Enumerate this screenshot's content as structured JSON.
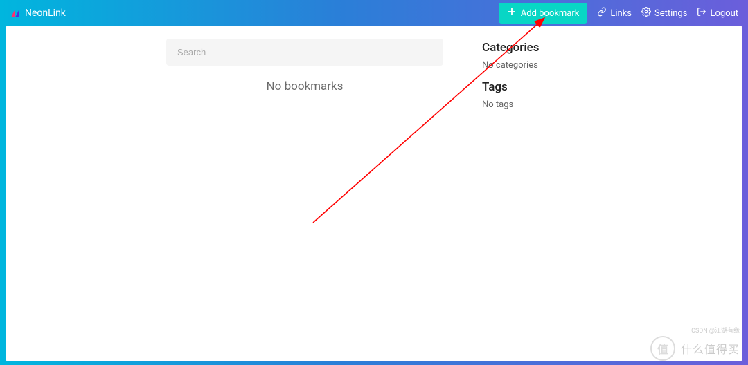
{
  "brand": {
    "name": "NeonLink"
  },
  "nav": {
    "add_bookmark": "Add bookmark",
    "links": "Links",
    "settings": "Settings",
    "logout": "Logout"
  },
  "search": {
    "placeholder": "Search"
  },
  "main": {
    "empty_message": "No bookmarks"
  },
  "sidebar": {
    "categories_heading": "Categories",
    "categories_empty": "No categories",
    "tags_heading": "Tags",
    "tags_empty": "No tags"
  },
  "watermark": {
    "badge": "值",
    "text": "什么值得买",
    "csdn": "CSDN @江湖有缘"
  }
}
